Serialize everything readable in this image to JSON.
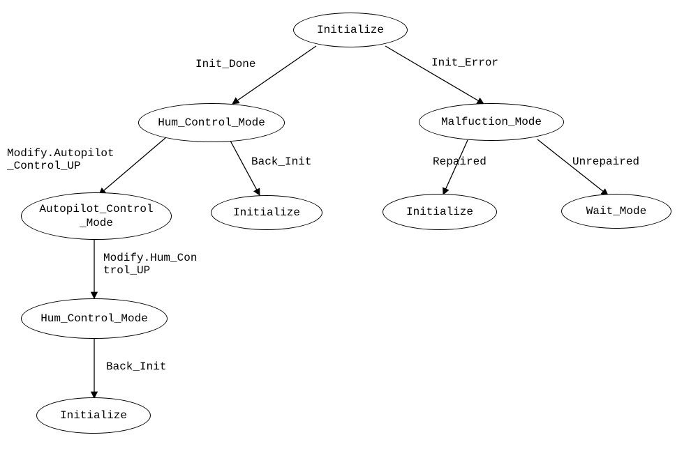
{
  "diagram_type": "state_transition_tree",
  "nodes": {
    "initialize_root": {
      "label": "Initialize"
    },
    "hum_control_mode_l1": {
      "label": "Hum_Control_Mode"
    },
    "malfunction_mode": {
      "label": "Malfuction_Mode"
    },
    "autopilot_control_mode": {
      "label": "Autopilot_Control\n_Mode"
    },
    "initialize_hum_back": {
      "label": "Initialize"
    },
    "initialize_repaired": {
      "label": "Initialize"
    },
    "wait_mode": {
      "label": "Wait_Mode"
    },
    "hum_control_mode_l3": {
      "label": "Hum_Control_Mode"
    },
    "initialize_bottom": {
      "label": "Initialize"
    }
  },
  "edges": {
    "init_done": {
      "label": "Init_Done"
    },
    "init_error": {
      "label": "Init_Error"
    },
    "modify_autopilot_up": {
      "label": "Modify.Autopilot\n_Control_UP"
    },
    "back_init_hum": {
      "label": "Back_Init"
    },
    "repaired": {
      "label": "Repaired"
    },
    "unrepaired": {
      "label": "Unrepaired"
    },
    "modify_hum_up": {
      "label": "Modify.Hum_Con\ntrol_UP"
    },
    "back_init_bottom": {
      "label": "Back_Init"
    }
  }
}
